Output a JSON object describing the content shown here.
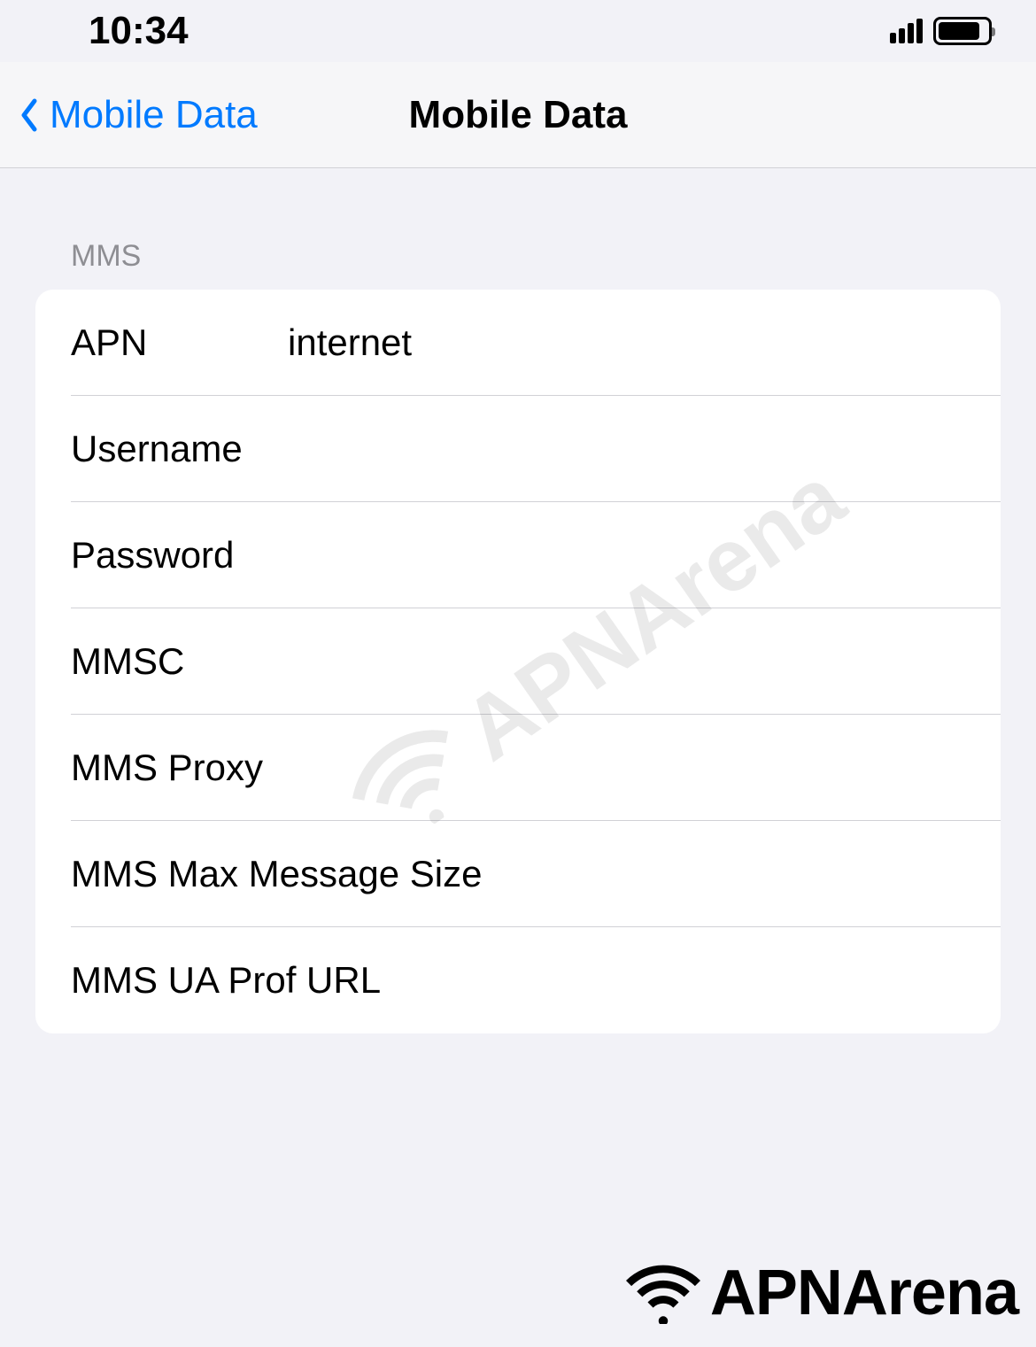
{
  "status": {
    "time": "10:34"
  },
  "nav": {
    "back_label": "Mobile Data",
    "title": "Mobile Data"
  },
  "section": {
    "header": "MMS",
    "rows": [
      {
        "label": "APN",
        "value": "internet"
      },
      {
        "label": "Username",
        "value": ""
      },
      {
        "label": "Password",
        "value": ""
      },
      {
        "label": "MMSC",
        "value": ""
      },
      {
        "label": "MMS Proxy",
        "value": ""
      },
      {
        "label": "MMS Max Message Size",
        "value": ""
      },
      {
        "label": "MMS UA Prof URL",
        "value": ""
      }
    ]
  },
  "watermark": {
    "text": "APNArena"
  }
}
